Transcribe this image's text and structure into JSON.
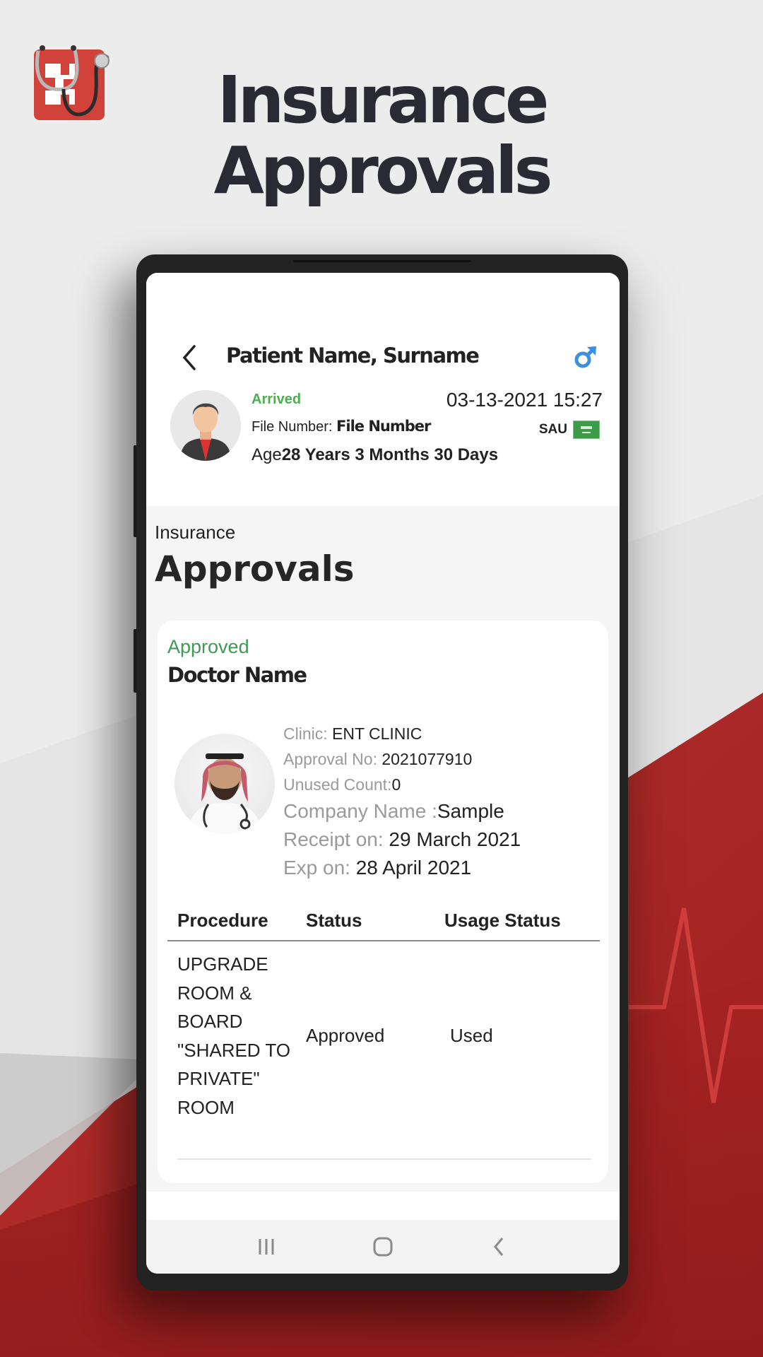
{
  "promo": {
    "title_line1": "Insurance",
    "title_line2": "Approvals"
  },
  "header": {
    "patient_name": "Patient Name, Surname",
    "gender_icon": "male-symbol-icon",
    "status": "Arrived",
    "datetime": "03-13-2021 15:27",
    "file_number_label": "File Number:",
    "file_number_value": "File Number",
    "country_code": "SAU",
    "age_label": "Age",
    "age_value": "28 Years  3 Months 30 Days"
  },
  "page": {
    "kicker": "Insurance",
    "title": "Approvals"
  },
  "approval_card": {
    "status": "Approved",
    "doctor_name": "Doctor Name",
    "details": [
      {
        "label": "Clinic: ",
        "value": "ENT CLINIC"
      },
      {
        "label": "Approval No: ",
        "value": "2021077910"
      },
      {
        "label": "Unused Count:",
        "value": "0"
      },
      {
        "label": "Company Name :",
        "value": "Sample"
      },
      {
        "label": "Receipt on: ",
        "value": "29 March 2021"
      },
      {
        "label": "Exp on: ",
        "value": "28 April 2021"
      }
    ],
    "table": {
      "headers": [
        "Procedure",
        "Status",
        "Usage Status"
      ],
      "rows": [
        {
          "procedure_lines": [
            "UPGRADE",
            "ROOM &",
            "BOARD",
            "\"SHARED TO",
            "PRIVATE\"",
            "ROOM"
          ],
          "status": "Approved",
          "usage_status": "Used"
        }
      ]
    }
  },
  "colors": {
    "status_green": "#4caf50",
    "brand_red": "#b22222",
    "gender_blue": "#3d8fe0"
  },
  "navbar": {
    "items": [
      "recent-apps",
      "home",
      "back"
    ]
  }
}
